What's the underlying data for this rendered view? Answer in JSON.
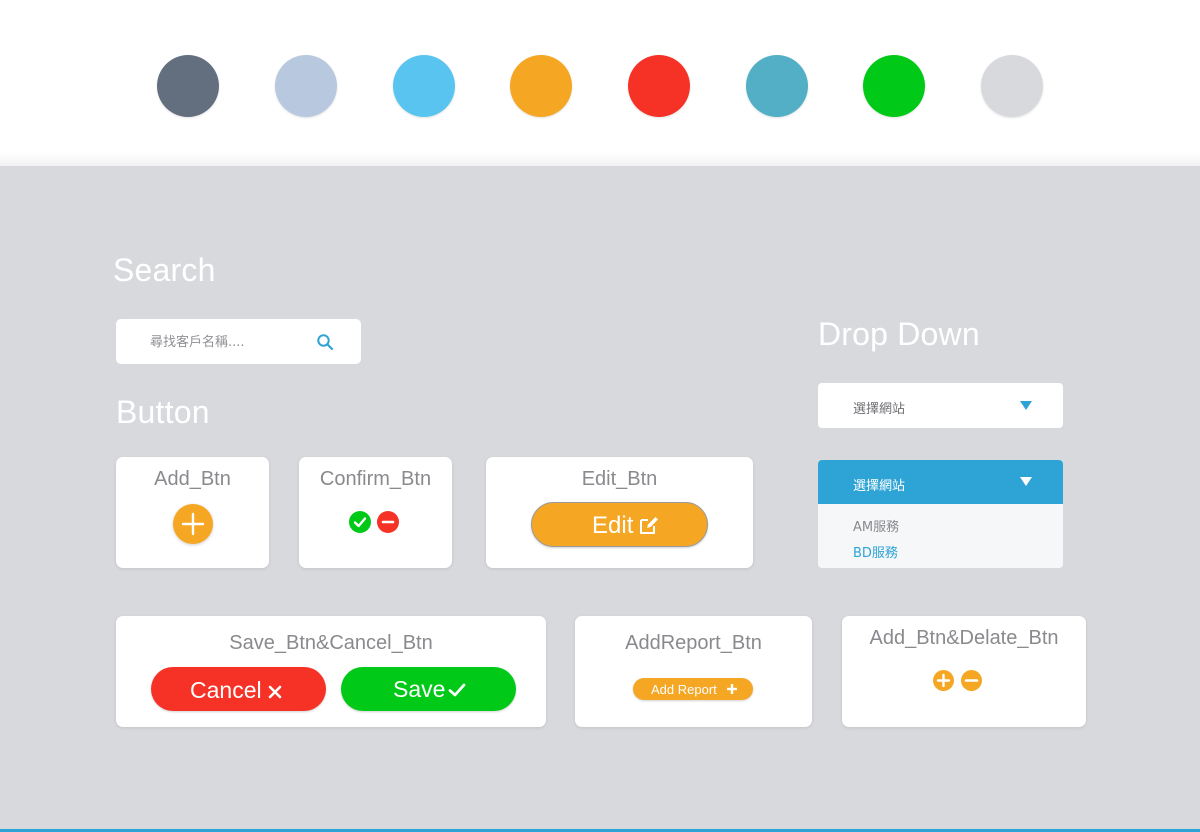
{
  "palette": {
    "colors": [
      "#636f7f",
      "#b8c9df",
      "#5ac4f0",
      "#f5a623",
      "#f63226",
      "#52afc5",
      "#00c917",
      "#d8d9dd"
    ]
  },
  "search": {
    "title": "Search",
    "placeholder": "尋找客戶名稱....",
    "icon": "search-icon"
  },
  "button_section": {
    "title": "Button",
    "add_btn": {
      "title": "Add_Btn",
      "icon": "plus-icon"
    },
    "confirm_btn": {
      "title": "Confirm_Btn",
      "confirm_icon": "check-icon",
      "cancel_icon": "minus-icon"
    },
    "edit_btn": {
      "title": "Edit_Btn",
      "label": "Edit",
      "icon": "edit-icon"
    },
    "save_cancel": {
      "title": "Save_Btn&Cancel_Btn",
      "cancel_label": "Cancel",
      "save_label": "Save"
    },
    "add_report": {
      "title": "AddReport_Btn",
      "label": "Add Report"
    },
    "add_delete": {
      "title": "Add_Btn&Delate_Btn"
    }
  },
  "dropdown": {
    "title": "Drop Down",
    "collapsed_label": "選擇網站",
    "expanded_label": "選擇網站",
    "options": [
      "AM服務",
      "BD服務"
    ]
  },
  "colors": {
    "accent_blue": "#2ea3d5",
    "orange": "#f5a623",
    "red": "#f63226",
    "green": "#00c917"
  }
}
